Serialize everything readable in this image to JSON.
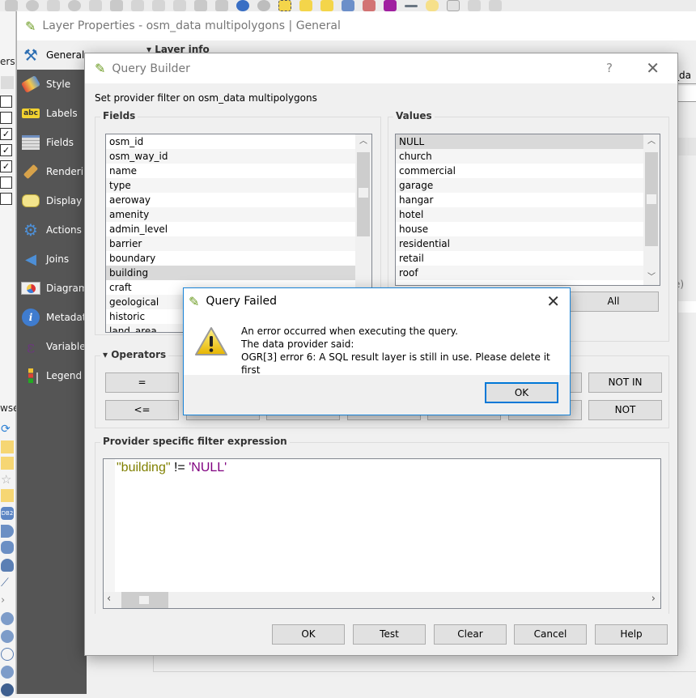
{
  "toolbar": {
    "icons": [
      "identify-icon",
      "run-action-icon",
      "select-features-icon",
      "select-by-expression-icon",
      "deselect-icon",
      "attribute-table-icon",
      "field-calculator-icon",
      "statistics-icon",
      "measure-line-icon",
      "annotation-icon",
      "text-annotation-icon",
      "measure-icon",
      "pencil-icon"
    ]
  },
  "background_panels": {
    "layers_label": "ers",
    "browser_label": "wse",
    "layer_checks": [
      false,
      false,
      true,
      true,
      true,
      false,
      false
    ]
  },
  "layer_properties": {
    "title": "Layer Properties - osm_data multipolygons | General",
    "section_title": "Layer info",
    "right_fragment_text_1": "_da",
    "right_fragment_text_2": "e)",
    "sidebar": [
      {
        "label": "General",
        "icon": "general-tools-icon",
        "active": true
      },
      {
        "label": "Style",
        "icon": "style-brush-icon"
      },
      {
        "label": "Labels",
        "icon": "labels-abc-icon"
      },
      {
        "label": "Fields",
        "icon": "fields-table-icon"
      },
      {
        "label": "Rendering",
        "icon": "rendering-brush-icon"
      },
      {
        "label": "Display",
        "icon": "display-speech-icon"
      },
      {
        "label": "Actions",
        "icon": "actions-gear-icon"
      },
      {
        "label": "Joins",
        "icon": "joins-arrow-icon"
      },
      {
        "label": "Diagrams",
        "icon": "diagrams-pie-icon"
      },
      {
        "label": "Metadata",
        "icon": "metadata-info-icon"
      },
      {
        "label": "Variables",
        "icon": "variables-epsilon-icon"
      },
      {
        "label": "Legend",
        "icon": "legend-icon"
      }
    ]
  },
  "query_builder": {
    "title": "Query Builder",
    "help_label": "?",
    "subtitle": "Set provider filter on osm_data multipolygons",
    "fields_title": "Fields",
    "fields": [
      "osm_id",
      "osm_way_id",
      "name",
      "type",
      "aeroway",
      "amenity",
      "admin_level",
      "barrier",
      "boundary",
      "building",
      "craft",
      "geological",
      "historic",
      "land_area"
    ],
    "selected_field": "building",
    "values_title": "Values",
    "values": [
      "NULL",
      "church",
      "commercial",
      "garage",
      "hangar",
      "hotel",
      "house",
      "residential",
      "retail",
      "roof"
    ],
    "selected_value": "NULL",
    "all_button": "All",
    "operators_title": "Operators",
    "operators_row1": [
      "=",
      "",
      "",
      "",
      "",
      "",
      "NOT IN"
    ],
    "operators_row2": [
      "<=",
      "",
      "",
      "",
      "",
      "",
      "NOT"
    ],
    "expression_title": "Provider specific filter expression",
    "expression": {
      "field": "\"building\"",
      "operator": " != ",
      "value": "'NULL'"
    },
    "buttons": {
      "ok": "OK",
      "test": "Test",
      "clear": "Clear",
      "cancel": "Cancel",
      "help": "Help"
    }
  },
  "query_failed": {
    "title": "Query Failed",
    "message_lines": [
      "An error occurred when executing the query.",
      "The data provider said:",
      "OGR[3] error 6: A SQL result layer is still in use. Please delete it first"
    ],
    "ok_label": "OK"
  },
  "colors": {
    "accent": "#0078d7",
    "sidebar_bg": "#555555",
    "expr_field": "#808000",
    "expr_string": "#800080"
  }
}
